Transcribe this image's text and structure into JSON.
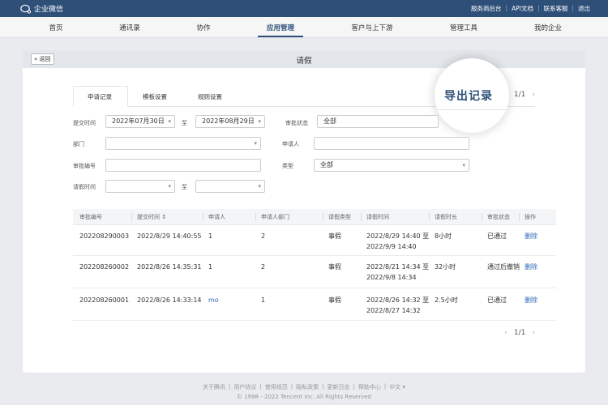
{
  "app": {
    "logo_text": "企业微信"
  },
  "top_links": [
    "服务商后台",
    "API文档",
    "联系客服",
    "退出"
  ],
  "nav": {
    "items": [
      "首页",
      "通讯录",
      "协作",
      "应用管理",
      "客户与上下游",
      "管理工具",
      "我的企业"
    ],
    "active_index": 3
  },
  "page": {
    "back_label": "« 返回",
    "title": "请假"
  },
  "tabs": {
    "items": [
      "申请记录",
      "模板设置",
      "规则设置"
    ],
    "active_index": 0
  },
  "magnifier": {
    "text": "导出记录"
  },
  "pager_top": {
    "page": "1/1"
  },
  "filters": {
    "submit_time_label": "提交时间",
    "submit_start": "2022年07月30日",
    "submit_end": "2022年08月29日",
    "to_label": "至",
    "status_label": "审批状态",
    "status_value": "全部",
    "dept_label": "部门",
    "dept_value": "",
    "applicant_label": "申请人",
    "applicant_value": "",
    "number_label": "审批编号",
    "number_value": "",
    "type_label": "类型",
    "type_value": "全部",
    "leave_time_label": "请假时间",
    "leave_start": "",
    "leave_end": ""
  },
  "table": {
    "headers": [
      "审批编号",
      "提交时间 ↕",
      "申请人",
      "申请人部门",
      "请假类型",
      "请假时间",
      "请假时长",
      "审批状态",
      "操作"
    ],
    "rows": [
      {
        "id": "202208290003",
        "submitted": "2022/8/29 14:40:55",
        "applicant": "1",
        "dept": "2",
        "type": "事假",
        "time_line1": "2022/8/29 14:40 至",
        "time_line2": "2022/9/9 14:40",
        "duration": "8小时",
        "status": "已通过",
        "action": "删除"
      },
      {
        "id": "202208260002",
        "submitted": "2022/8/26 14:35:31",
        "applicant": "1",
        "dept": "2",
        "type": "事假",
        "time_line1": "2022/8/21 14:34 至",
        "time_line2": "2022/9/8 14:34",
        "duration": "32小时",
        "status": "通过后撤销",
        "action": "删除"
      },
      {
        "id": "202208260001",
        "submitted": "2022/8/26 14:33:14",
        "applicant": "mo",
        "dept": "1",
        "type": "事假",
        "time_line1": "2022/8/26 14:32 至",
        "time_line2": "2022/8/27 14:32",
        "duration": "2.5小时",
        "status": "已通过",
        "action": "删除"
      }
    ]
  },
  "pager_bottom": {
    "page": "1/1"
  },
  "footer": {
    "links": [
      "关于腾讯",
      "用户协议",
      "使用规范",
      "隐私政策",
      "更新日志",
      "帮助中心",
      "中文 ▾"
    ],
    "copyright": "© 1998 - 2022 Tencent Inc. All Rights Reserved"
  },
  "colors": {
    "brand": "#2e4f78",
    "link": "#2e69b5"
  },
  "icons": {
    "logo": "wecom-chat-bubble-icon",
    "prev": "chevron-left-icon",
    "next": "chevron-right-icon",
    "dropdown": "chevron-down-icon"
  }
}
